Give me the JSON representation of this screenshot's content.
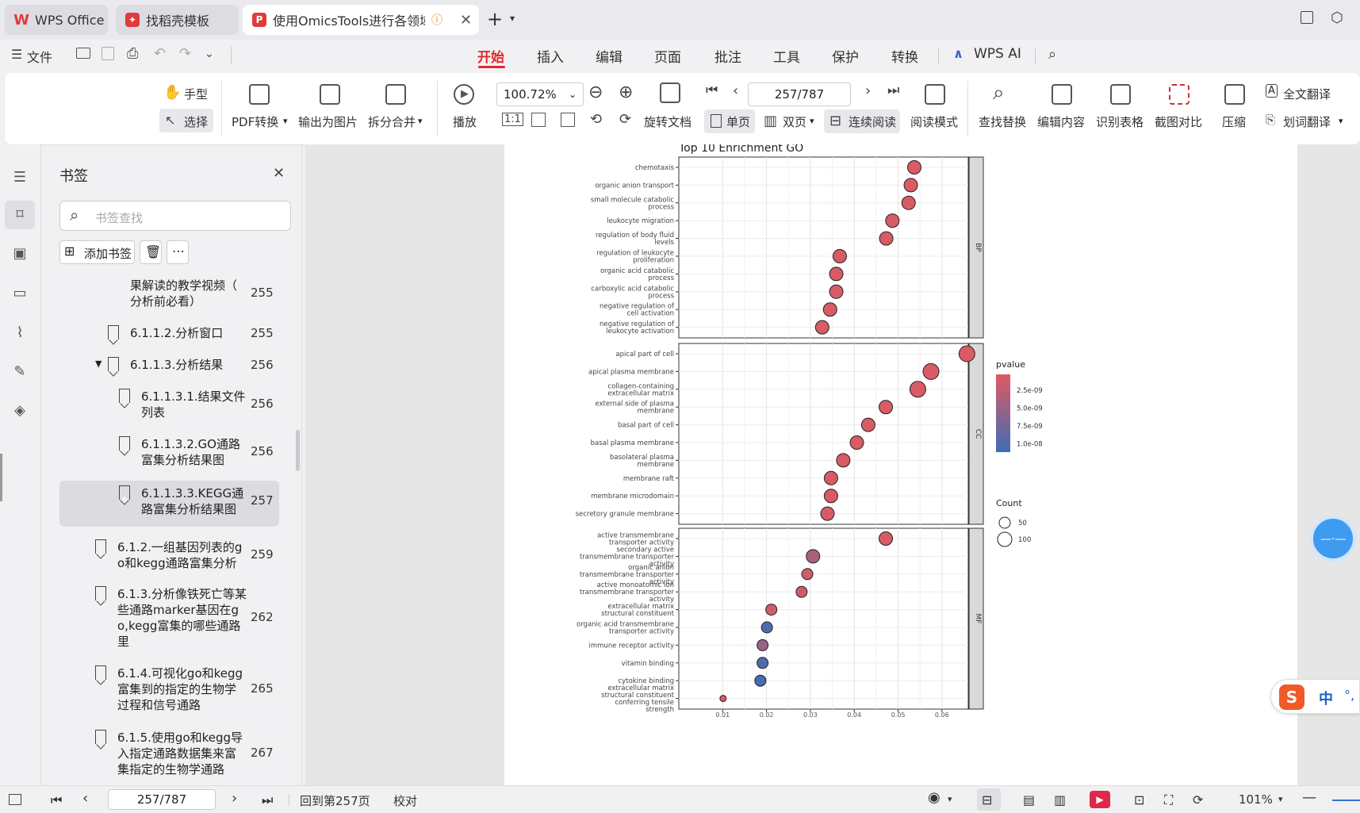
{
  "tabs": [
    {
      "label": "WPS Office"
    },
    {
      "label": "找稻壳模板"
    },
    {
      "label": "使用OmicsTools进行各领域"
    }
  ],
  "menu": {
    "file_label": "文件",
    "items": [
      "开始",
      "插入",
      "编辑",
      "页面",
      "批注",
      "工具",
      "保护",
      "转换"
    ],
    "ai_label": "WPS AI"
  },
  "ribbon": {
    "hand": "手型",
    "select": "选择",
    "pdf_convert": "PDF转换",
    "export_image": "输出为图片",
    "split_merge": "拆分合并",
    "play": "播放",
    "zoom": "100.72%",
    "page_input": "257/787",
    "rotate": "旋转文档",
    "single": "单页",
    "double": "双页",
    "continuous": "连续阅读",
    "read_mode": "阅读模式",
    "find_replace": "查找替换",
    "edit_content": "编辑内容",
    "recognize_table": "识别表格",
    "screenshot_compare": "截图对比",
    "compress": "压缩",
    "full_translate": "全文翻译",
    "word_translate": "划词翻译"
  },
  "bookmarks": {
    "title": "书签",
    "search_placeholder": "书签查找",
    "add_label": "添加书签",
    "items": [
      {
        "text": "果解读的教学视频（",
        "text2": "分析前必看）",
        "page": "255"
      },
      {
        "text": "6.1.1.2.分析窗口",
        "page": "255"
      },
      {
        "text": "6.1.1.3.分析结果",
        "page": "256"
      },
      {
        "text": "6.1.1.3.1.结果文件",
        "text2": "列表",
        "page": "256"
      },
      {
        "text": "6.1.1.3.2.GO通路",
        "text2": "富集分析结果图",
        "page": "256"
      },
      {
        "text": "6.1.1.3.3.KEGG通",
        "text2": "路富集分析结果图",
        "page": "257"
      },
      {
        "text": "6.1.2.一组基因列表的g",
        "text2": "o和kegg通路富集分析",
        "page": "259"
      },
      {
        "text": "6.1.3.分析像铁死亡等某",
        "text2": "些通路marker基因在g",
        "text3": "o,kegg富集的哪些通路",
        "text4": "里",
        "page": "262"
      },
      {
        "text": "6.1.4.可视化go和kegg",
        "text2": "富集到的指定的生物学",
        "text3": "过程和信号通路",
        "page": "265"
      },
      {
        "text": "6.1.5.使用go和kegg导",
        "text2": "入指定通路数据集来富",
        "text3": "集指定的生物学通路",
        "page": "267"
      }
    ]
  },
  "status": {
    "page_input": "257/787",
    "goto_label": "回到第257页",
    "proof_label": "校对",
    "zoom": "101%"
  },
  "ime": {
    "label": "中"
  },
  "chart_data": {
    "type": "scatter",
    "title": "Top 10 Enrichment GO",
    "xlim": [
      0.0,
      0.066
    ],
    "xticks": [
      "0.01",
      "0.02",
      "0.03",
      "0.04",
      "0.05",
      "0.06"
    ],
    "color_legend": {
      "title": "pvalue",
      "ticks": [
        "2.5e-09",
        "5.0e-09",
        "7.5e-09",
        "1.0e-08"
      ],
      "low_color": "#e05a62",
      "high_color": "#3e6db5"
    },
    "size_legend": {
      "title": "Count",
      "ticks": [
        "50",
        "100"
      ]
    },
    "panels": [
      {
        "name": "BP",
        "terms": [
          {
            "label": "chemotaxis",
            "x": 0.0537,
            "pv": 0.05
          },
          {
            "label": "organic anion transport",
            "x": 0.0529,
            "pv": 0.05
          },
          {
            "label": "small molecule catabolic process",
            "x": 0.0524,
            "pv": 0.05
          },
          {
            "label": "leukocyte migration",
            "x": 0.0487,
            "pv": 0.05
          },
          {
            "label": "regulation of body fluid levels",
            "x": 0.0473,
            "pv": 0.05
          },
          {
            "label": "regulation of leukocyte proliferation",
            "x": 0.0367,
            "pv": 0.05
          },
          {
            "label": "organic acid catabolic process",
            "x": 0.0359,
            "pv": 0.05
          },
          {
            "label": "carboxylic acid catabolic process",
            "x": 0.0359,
            "pv": 0.05
          },
          {
            "label": "negative regulation of cell activation",
            "x": 0.0345,
            "pv": 0.05
          },
          {
            "label": "negative regulation of leukocyte activation",
            "x": 0.0327,
            "pv": 0.05
          }
        ]
      },
      {
        "name": "CC",
        "terms": [
          {
            "label": "apical part of cell",
            "x": 0.0657,
            "pv": 0.05
          },
          {
            "label": "apical plasma membrane",
            "x": 0.0575,
            "pv": 0.05
          },
          {
            "label": "collagen-containing extracellular matrix",
            "x": 0.0545,
            "pv": 0.05
          },
          {
            "label": "external side of plasma membrane",
            "x": 0.0472,
            "pv": 0.05
          },
          {
            "label": "basal part of cell",
            "x": 0.0432,
            "pv": 0.05
          },
          {
            "label": "basal plasma membrane",
            "x": 0.0406,
            "pv": 0.05
          },
          {
            "label": "basolateral plasma membrane",
            "x": 0.0375,
            "pv": 0.05
          },
          {
            "label": "membrane raft",
            "x": 0.0347,
            "pv": 0.05
          },
          {
            "label": "membrane microdomain",
            "x": 0.0347,
            "pv": 0.05
          },
          {
            "label": "secretory granule membrane",
            "x": 0.0339,
            "pv": 0.05
          }
        ]
      },
      {
        "name": "MF",
        "terms": [
          {
            "label": "active transmembrane transporter activity",
            "x": 0.0472,
            "pv": 0.05
          },
          {
            "label": "secondary active transmembrane transporter activity",
            "x": 0.0306,
            "pv": 0.35
          },
          {
            "label": "organic anion transmembrane transporter activity",
            "x": 0.0293,
            "pv": 0.1
          },
          {
            "label": "active monoatomic ion transmembrane transporter activity",
            "x": 0.028,
            "pv": 0.1
          },
          {
            "label": "extracellular matrix structural constituent",
            "x": 0.0211,
            "pv": 0.1
          },
          {
            "label": "organic acid transmembrane transporter activity",
            "x": 0.0201,
            "pv": 0.9
          },
          {
            "label": "immune receptor activity",
            "x": 0.0191,
            "pv": 0.45
          },
          {
            "label": "vitamin binding",
            "x": 0.0191,
            "pv": 0.9
          },
          {
            "label": "cytokine binding",
            "x": 0.0186,
            "pv": 0.95
          },
          {
            "label": "extracellular matrix structural constituent conferring tensile strength",
            "x": 0.0101,
            "pv": 0.1
          }
        ]
      }
    ]
  }
}
